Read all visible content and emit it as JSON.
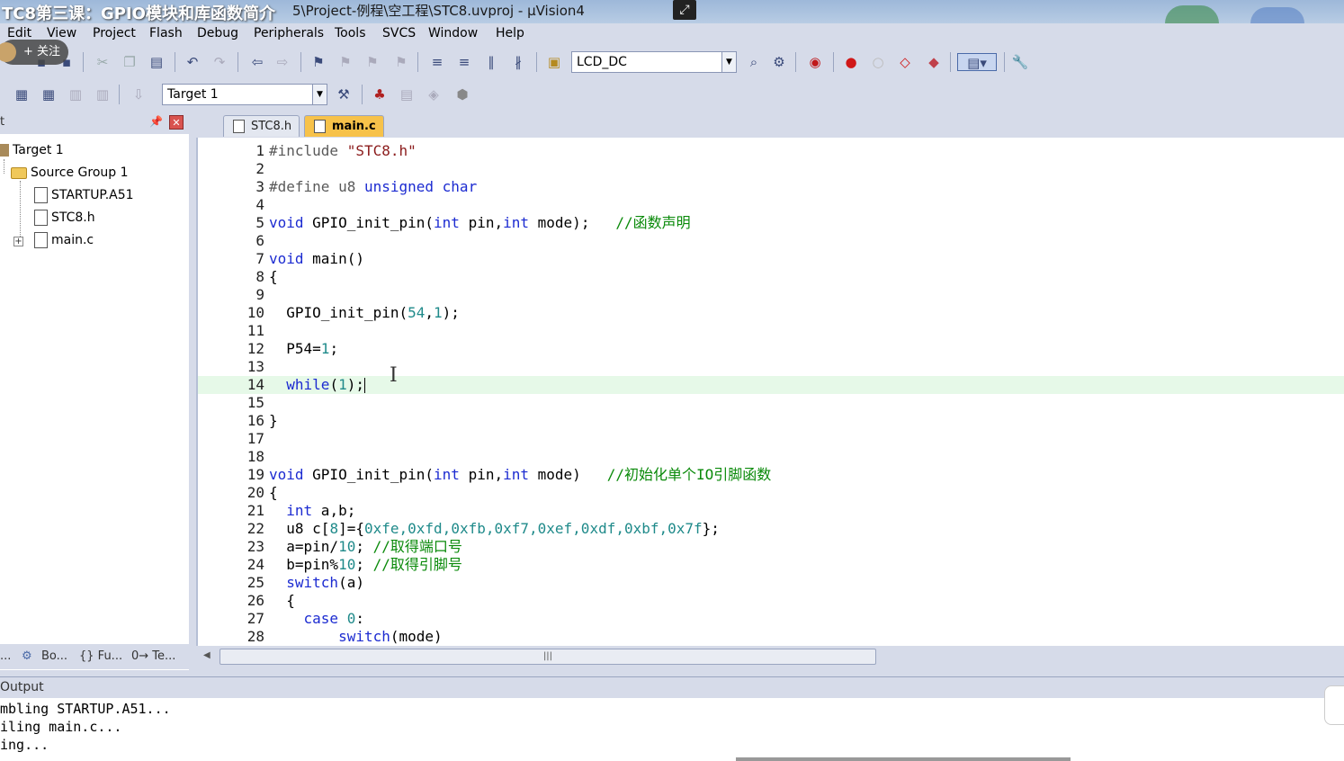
{
  "window": {
    "title_overlay": "TC8第三课：GPIO模块和库函数简介",
    "title_path": "5\\Project-例程\\空工程\\STC8.uvproj - µVision4"
  },
  "overlay": {
    "follow_label": "+ 关注"
  },
  "menu": [
    "Edit",
    "View",
    "Project",
    "Flash",
    "Debug",
    "Peripherals",
    "Tools",
    "SVCS",
    "Window",
    "Help"
  ],
  "toolbar": {
    "find_combo_value": "LCD_DC",
    "target_combo_value": "Target 1"
  },
  "project_panel": {
    "title": "t",
    "tree": {
      "target": "Target 1",
      "group": "Source Group 1",
      "files": [
        "STARTUP.A51",
        "STC8.h",
        "main.c"
      ]
    },
    "bottom_tabs": [
      "...",
      "Bo...",
      "{} Fu...",
      "0→ Te..."
    ]
  },
  "editor": {
    "tabs": [
      {
        "label": "STC8.h",
        "active": false
      },
      {
        "label": "main.c",
        "active": true
      }
    ],
    "active_line": 14,
    "lines": [
      {
        "n": "1"
      },
      {
        "n": "2"
      },
      {
        "n": "3"
      },
      {
        "n": "4"
      },
      {
        "n": "5"
      },
      {
        "n": "6"
      },
      {
        "n": "7"
      },
      {
        "n": "8"
      },
      {
        "n": "9"
      },
      {
        "n": "10"
      },
      {
        "n": "11"
      },
      {
        "n": "12"
      },
      {
        "n": "13"
      },
      {
        "n": "14"
      },
      {
        "n": "15"
      },
      {
        "n": "16"
      },
      {
        "n": "17"
      },
      {
        "n": "18"
      },
      {
        "n": "19"
      },
      {
        "n": "20"
      },
      {
        "n": "21"
      },
      {
        "n": "22"
      },
      {
        "n": "23"
      },
      {
        "n": "24"
      },
      {
        "n": "25"
      },
      {
        "n": "26"
      },
      {
        "n": "27"
      },
      {
        "n": "28"
      }
    ],
    "code": {
      "l1_pp": "#include ",
      "l1_str": "\"STC8.h\"",
      "l3_pp": "#define u8 ",
      "l3_kw": "unsigned char",
      "l5_a": "void",
      "l5_b": " GPIO_init_pin(",
      "l5_c": "int",
      "l5_d": " pin,",
      "l5_e": "int",
      "l5_f": " mode);   ",
      "l5_cmt": "//函数声明",
      "l7_a": "void",
      "l7_b": " main()",
      "l8": "{",
      "l10_a": "  GPIO_init_pin(",
      "l10_n1": "54",
      "l10_b": ",",
      "l10_n2": "1",
      "l10_c": ");",
      "l12_a": "  P54=",
      "l12_n": "1",
      "l12_b": ";",
      "l14_kw": "while",
      "l14_a": "(",
      "l14_n": "1",
      "l14_b": ");",
      "l16": "}",
      "l19_a": "void",
      "l19_b": " GPIO_init_pin(",
      "l19_c": "int",
      "l19_d": " pin,",
      "l19_e": "int",
      "l19_f": " mode)   ",
      "l19_cmt": "//初始化单个IO引脚函数",
      "l20": "{",
      "l21_kw": "int",
      "l21_a": " a,b;",
      "l22_a": "  u8 c[",
      "l22_n": "8",
      "l22_b": "]={",
      "l22_vals": "0xfe,0xfd,0xfb,0xf7,0xef,0xdf,0xbf,0x7f",
      "l22_c": "};",
      "l23_a": "  a=pin/",
      "l23_n": "10",
      "l23_b": "; ",
      "l23_cmt": "//取得端口号",
      "l24_a": "  b=pin%",
      "l24_n": "10",
      "l24_b": "; ",
      "l24_cmt": "//取得引脚号",
      "l25_kw": "switch",
      "l25_a": "(a)",
      "l26": "  {",
      "l27_kw": "case",
      "l27_n": "0",
      "l27_a": ":",
      "l28_kw": "switch",
      "l28_a": "(mode)"
    }
  },
  "output": {
    "title": "Output",
    "lines": [
      "mbling STARTUP.A51...",
      "iling main.c...",
      "ing..."
    ]
  },
  "colors": {
    "keyword": "#1c2bd1",
    "comment": "#0a8a0a",
    "number": "#1f8a8a",
    "string": "#8b1c1c",
    "active_line": "#e6f9e8",
    "active_tab": "#f7c24a"
  }
}
